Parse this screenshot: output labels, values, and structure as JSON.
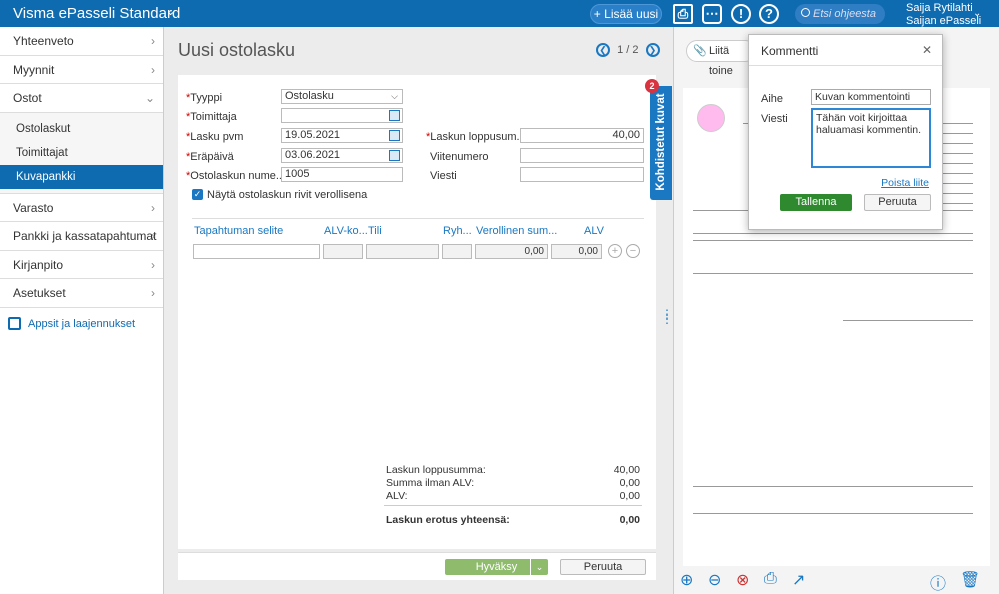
{
  "topbar": {
    "brand": "Visma ePasseli Standard",
    "add_label": "Lisää uusi",
    "search_placeholder": "Etsi ohjeesta",
    "user_name": "Saija Rytilahti",
    "user_company": "Saijan ePasseli"
  },
  "sidebar": {
    "items": [
      {
        "label": "Yhteenveto"
      },
      {
        "label": "Myynnit"
      },
      {
        "label": "Ostot"
      }
    ],
    "sub_items": [
      {
        "label": "Ostolaskut"
      },
      {
        "label": "Toimittajat"
      },
      {
        "label": "Kuvapankki"
      }
    ],
    "items2": [
      {
        "label": "Varasto"
      },
      {
        "label": "Pankki ja kassatapahtumat"
      },
      {
        "label": "Kirjanpito"
      },
      {
        "label": "Asetukset"
      }
    ],
    "apps_label": "Appsit ja laajennukset"
  },
  "page": {
    "title": "Uusi ostolasku",
    "pager": "1 / 2"
  },
  "form": {
    "type_label": "Tyyppi",
    "type_value": "Ostolasku",
    "supplier_label": "Toimittaja",
    "date_label": "Lasku pvm",
    "date_value": "19.05.2021",
    "due_label": "Eräpäivä",
    "due_value": "03.06.2021",
    "number_label": "Ostolaskun nume...",
    "number_value": "1005",
    "total_label": "Laskun loppusum...",
    "total_value": "40,00",
    "ref_label": "Viitenumero",
    "msg_label": "Viesti",
    "show_tax_label": "Näytä ostolaskun rivit verollisena"
  },
  "grid": {
    "headers": [
      "Tapahtuman selite",
      "ALV-ko...",
      "Tili",
      "Ryh...",
      "Verollinen sum...",
      "ALV"
    ],
    "row": {
      "amount": "0,00",
      "vat": "0,00"
    }
  },
  "summary": [
    {
      "label": "Laskun loppusumma:",
      "value": "40,00"
    },
    {
      "label": "Summa ilman ALV:",
      "value": "0,00"
    },
    {
      "label": "ALV:",
      "value": "0,00"
    },
    {
      "label": "Laskun erotus yhteensä:",
      "value": "0,00"
    }
  ],
  "footer": {
    "approve_label": "Hyväksy",
    "cancel_label": "Peruuta"
  },
  "side_tab": {
    "label": "Kohdistetut kuvat",
    "badge": "2"
  },
  "viewer": {
    "attach_label": "Liitä toine"
  },
  "modal": {
    "title": "Kommentti",
    "subject_label": "Aihe",
    "subject_value": "Kuvan kommentointi",
    "message_label": "Viesti",
    "message_value": "Tähän voit kirjoittaa haluamasi kommentin.",
    "remove_link": "Poista liite",
    "save_label": "Tallenna",
    "cancel_label": "Peruuta"
  },
  "colors": {
    "primary": "#0f6bb0",
    "approve": "#8fbc6c",
    "save": "#2f8a2f",
    "badge": "#d9333f"
  }
}
